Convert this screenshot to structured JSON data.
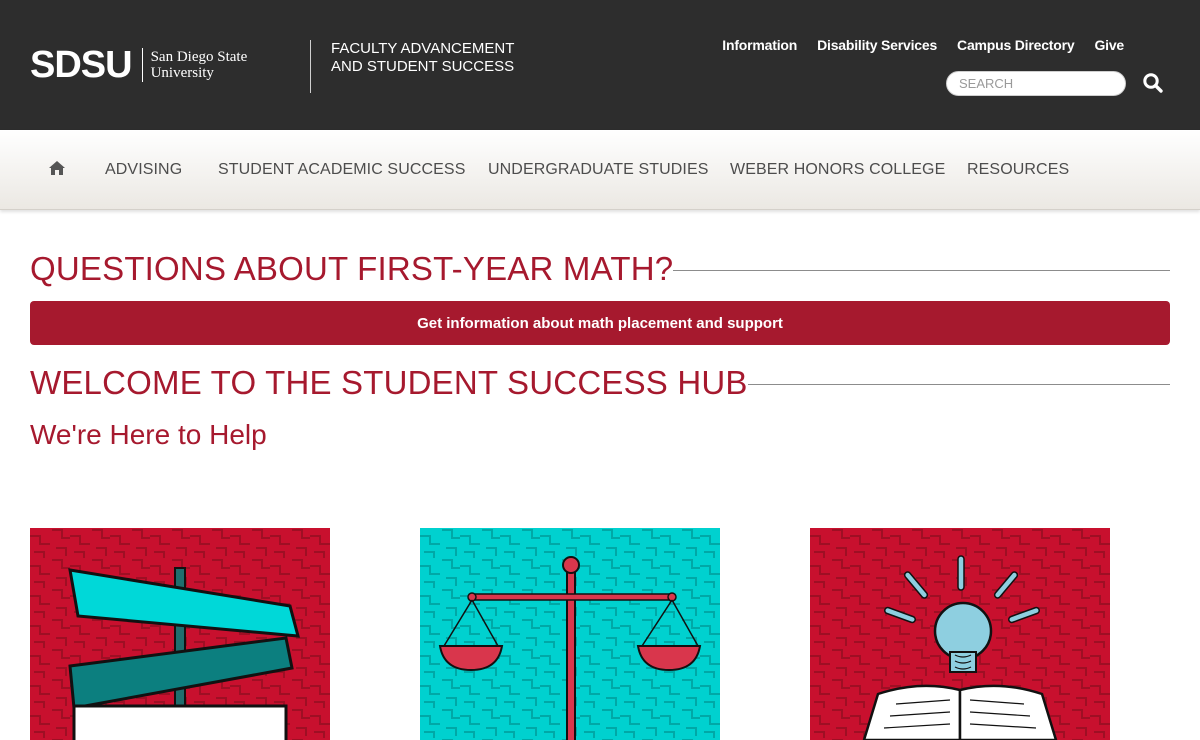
{
  "header": {
    "logo_mark": "SDSU",
    "logo_line1": "San Diego State",
    "logo_line2": "University",
    "department_line1": "FACULTY ADVANCEMENT",
    "department_line2": "AND STUDENT SUCCESS",
    "utility_links": [
      "Information",
      "Disability Services",
      "Campus Directory",
      "Give"
    ],
    "search_placeholder": "SEARCH",
    "search_icon": "search-icon"
  },
  "nav": {
    "home_icon": "home-icon",
    "items": [
      "ADVISING",
      "STUDENT ACADEMIC SUCCESS",
      "UNDERGRADUATE STUDIES",
      "WEBER HONORS COLLEGE",
      "RESOURCES"
    ]
  },
  "main": {
    "math_heading": "QUESTIONS ABOUT FIRST-YEAR MATH?",
    "math_button": "Get information about math placement and support",
    "welcome_heading": "WELCOME TO THE STUDENT SUCCESS HUB",
    "welcome_subheading": "We're Here to Help",
    "cards": [
      {
        "image": "street-signs-illustration",
        "background": "#c8102e"
      },
      {
        "image": "balance-scale-illustration",
        "background": "#00d1cf"
      },
      {
        "image": "lightbulb-book-illustration",
        "background": "#c8102e"
      }
    ]
  },
  "colors": {
    "brand_red": "#a6192e",
    "header_bg": "#2d2d2d",
    "teal": "#00d1cf"
  }
}
